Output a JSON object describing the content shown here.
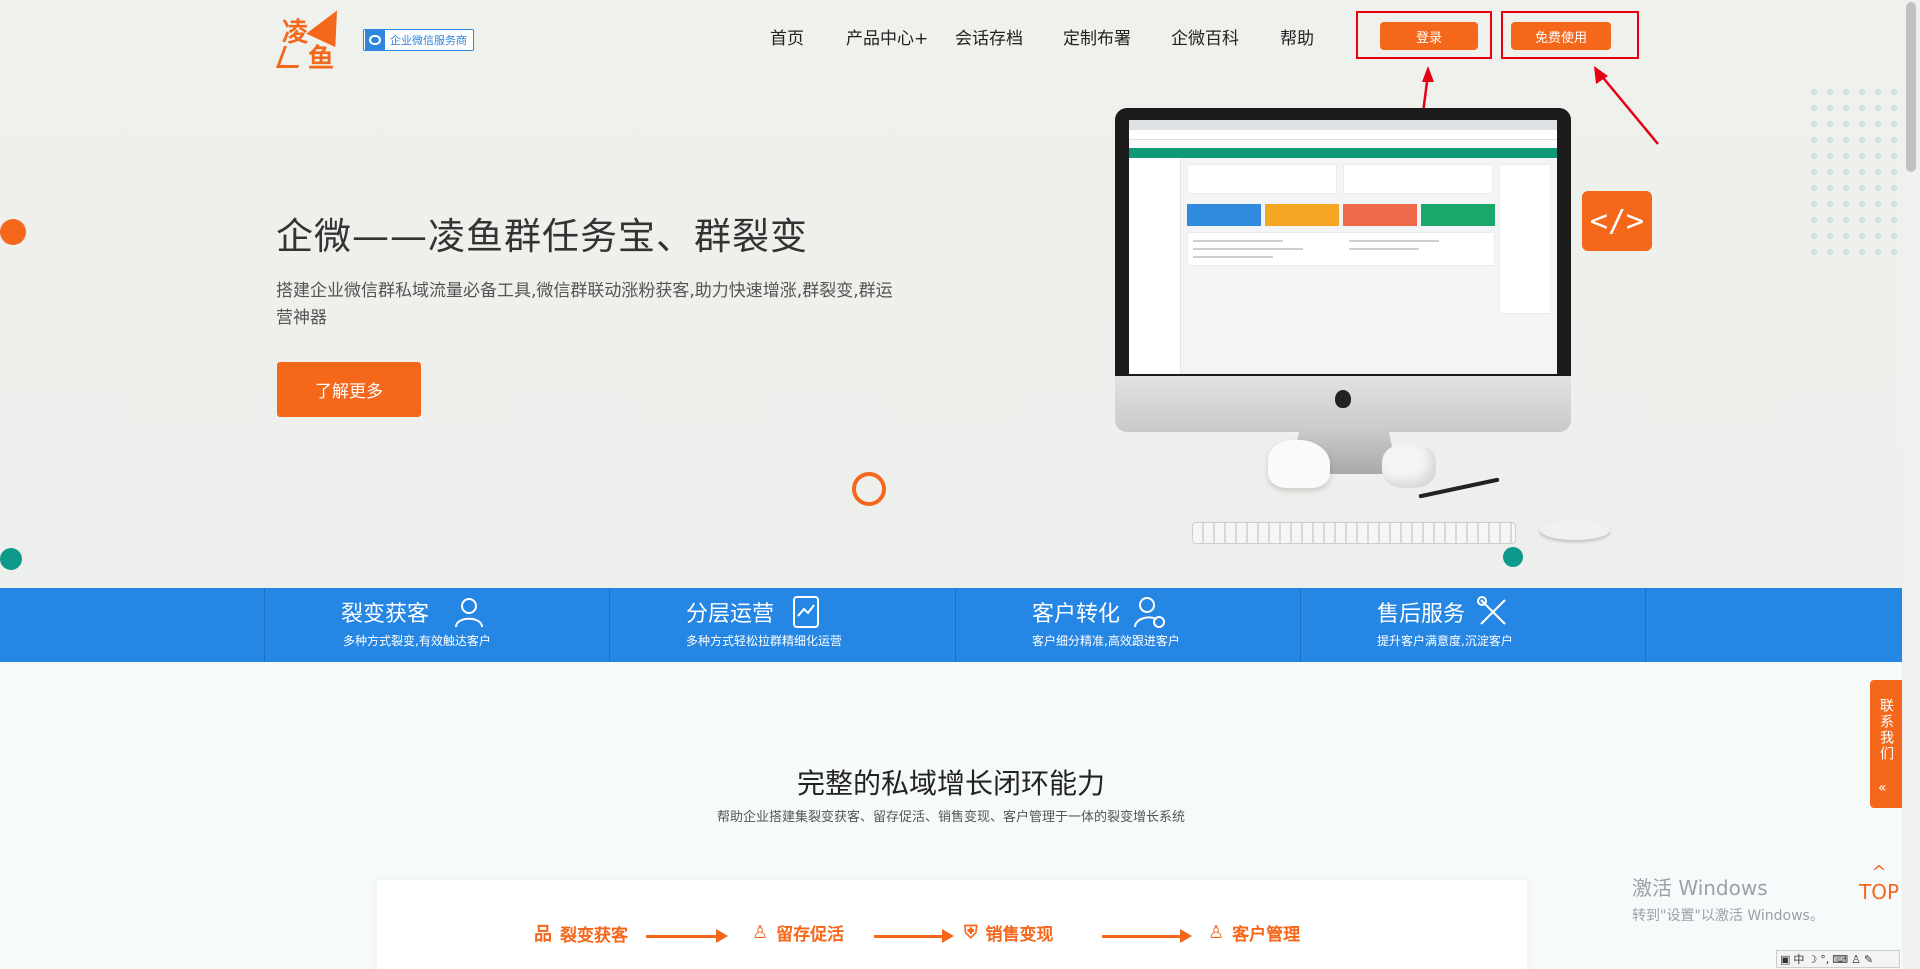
{
  "logo": {
    "char1": "凌",
    "char2": "鱼"
  },
  "badge": {
    "label": "企业微信服务商"
  },
  "nav": [
    {
      "label": "首页"
    },
    {
      "label": "产品中心+"
    },
    {
      "label": "会话存档"
    },
    {
      "label": "定制布署"
    },
    {
      "label": "企微百科"
    },
    {
      "label": "帮助"
    }
  ],
  "auth": {
    "login_label": "登录",
    "free_label": "免费使用"
  },
  "hero": {
    "title": "企微——凌鱼群任务宝、群裂变",
    "description": "搭建企业微信群私域流量必备工具,微信群联动涨粉获客,助力快速增涨,群裂变,群运营神器",
    "cta_label": "了解更多",
    "code_glyph": "</>"
  },
  "features": [
    {
      "title": "裂变获客",
      "subtitle": "多种方式裂变,有效触达客户",
      "icon": "users-icon"
    },
    {
      "title": "分层运营",
      "subtitle": "多种方式轻松拉群精细化运营",
      "icon": "chart-doc-icon"
    },
    {
      "title": "客户转化",
      "subtitle": "客户细分精准,高效跟进客户",
      "icon": "user-gear-icon"
    },
    {
      "title": "售后服务",
      "subtitle": "提升客户满意度,沉淀客户",
      "icon": "tools-icon"
    }
  ],
  "section": {
    "title": "完整的私域增长闭环能力",
    "subtitle": "帮助企业搭建集裂变获客、留存促活、销售变现、客户管理于一体的裂变增长系统"
  },
  "flow": [
    {
      "label": "裂变获客",
      "icon": "org-chart-icon"
    },
    {
      "label": "留存促活",
      "icon": "user-edit-icon"
    },
    {
      "label": "销售变现",
      "icon": "shield-icon"
    },
    {
      "label": "客户管理",
      "icon": "user-icon"
    }
  ],
  "contact": {
    "label": "联系我们",
    "chevron": "«"
  },
  "top": {
    "label": "TOP"
  },
  "windows": {
    "line1": "激活 Windows",
    "line2": "转到\"设置\"以激活 Windows。"
  },
  "ime": {
    "mode": "中"
  },
  "colors": {
    "accent": "#f5671b",
    "band": "#2586e3",
    "screen_header": "#0e9a78"
  }
}
